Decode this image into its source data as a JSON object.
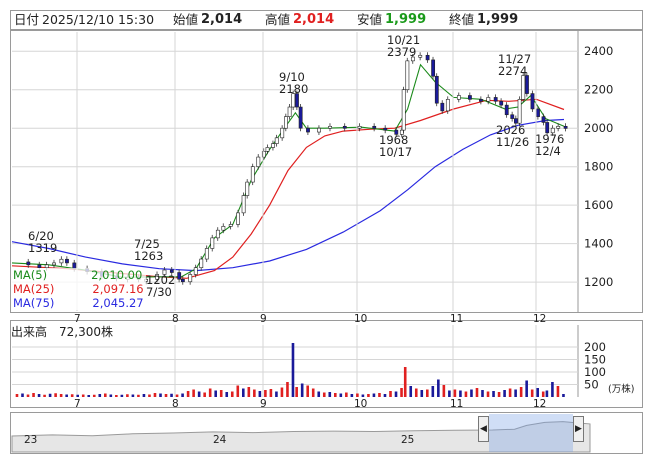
{
  "header": {
    "date_label": "日付",
    "date_value": "2025/12/10 15:30",
    "open_label": "始値",
    "open_value": "2,014",
    "high_label": "高値",
    "high_value": "2,014",
    "low_label": "安値",
    "low_value": "1,999",
    "close_label": "終値",
    "close_value": "1,999"
  },
  "legend": [
    {
      "label": "MA(5)",
      "value": "2,010.00",
      "color": "#1a8a1a"
    },
    {
      "label": "MA(25)",
      "value": "2,097.16",
      "color": "#e02020"
    },
    {
      "label": "MA(75)",
      "value": "2,045.27",
      "color": "#2a2ae0"
    }
  ],
  "volume_label": "出来高　72,300株",
  "colors": {
    "up": "#e02020",
    "down": "#1a1a9a",
    "ma5": "#1a8a1a",
    "ma25": "#e02020",
    "ma75": "#2a2ae0",
    "grid": "#d6d6d6"
  },
  "chart_data": {
    "type": "candlestick",
    "price_axis": {
      "ticks": [
        "1200",
        "1400",
        "1600",
        "1800",
        "2000",
        "2200",
        "2400"
      ],
      "range": [
        1050,
        2500
      ]
    },
    "month_ticks": [
      "7",
      "8",
      "9",
      "10",
      "11",
      "12"
    ],
    "volume_axis": {
      "ticks": [
        "200",
        "150",
        "100",
        "50"
      ],
      "unit": "(万株)",
      "range": [
        0,
        240
      ]
    },
    "annotations": [
      {
        "text": "6/20",
        "value": "1319"
      },
      {
        "text": "7/25",
        "value": "1263"
      },
      {
        "text": "1202",
        "value": "7/30"
      },
      {
        "text": "9/10",
        "value": "2180"
      },
      {
        "text": "10/21",
        "value": "2379"
      },
      {
        "text": "1968",
        "value": "10/17"
      },
      {
        "text": "11/27",
        "value": "2274"
      },
      {
        "text": "2026",
        "value": "11/26"
      },
      {
        "text": "1976",
        "value": "12/4"
      }
    ],
    "price_path": [
      [
        0,
        1305
      ],
      [
        8,
        1290
      ],
      [
        14,
        1275
      ],
      [
        18,
        1290
      ],
      [
        22,
        1300
      ],
      [
        26,
        1319
      ],
      [
        29,
        1300
      ],
      [
        33,
        1270
      ],
      [
        40,
        1255
      ],
      [
        48,
        1230
      ],
      [
        56,
        1220
      ],
      [
        62,
        1225
      ],
      [
        68,
        1215
      ],
      [
        72,
        1215
      ],
      [
        78,
        1240
      ],
      [
        82,
        1263
      ],
      [
        86,
        1250
      ],
      [
        90,
        1215
      ],
      [
        92,
        1202
      ],
      [
        96,
        1240
      ],
      [
        99,
        1275
      ],
      [
        102,
        1320
      ],
      [
        105,
        1375
      ],
      [
        108,
        1430
      ],
      [
        111,
        1470
      ],
      [
        114,
        1490
      ],
      [
        118,
        1500
      ],
      [
        122,
        1560
      ],
      [
        125,
        1650
      ],
      [
        127,
        1720
      ],
      [
        130,
        1800
      ],
      [
        133,
        1850
      ],
      [
        136,
        1880
      ],
      [
        138,
        1900
      ],
      [
        141,
        1920
      ],
      [
        143,
        1950
      ],
      [
        146,
        2000
      ],
      [
        148,
        2060
      ],
      [
        150,
        2110
      ],
      [
        152,
        2180
      ],
      [
        154,
        2110
      ],
      [
        156,
        2000
      ],
      [
        160,
        1980
      ],
      [
        166,
        2000
      ],
      [
        172,
        2010
      ],
      [
        180,
        2000
      ],
      [
        188,
        2010
      ],
      [
        196,
        2000
      ],
      [
        202,
        1990
      ],
      [
        208,
        1968
      ],
      [
        211,
        1990
      ],
      [
        212,
        2200
      ],
      [
        214,
        2350
      ],
      [
        217,
        2370
      ],
      [
        221,
        2379
      ],
      [
        225,
        2355
      ],
      [
        228,
        2270
      ],
      [
        230,
        2130
      ],
      [
        233,
        2090
      ],
      [
        236,
        2150
      ],
      [
        242,
        2170
      ],
      [
        248,
        2150
      ],
      [
        254,
        2140
      ],
      [
        258,
        2160
      ],
      [
        262,
        2140
      ],
      [
        265,
        2120
      ],
      [
        268,
        2070
      ],
      [
        271,
        2050
      ],
      [
        273,
        2026
      ],
      [
        275,
        2150
      ],
      [
        277,
        2274
      ],
      [
        279,
        2180
      ],
      [
        282,
        2100
      ],
      [
        285,
        2060
      ],
      [
        288,
        2030
      ],
      [
        290,
        1976
      ],
      [
        293,
        2000
      ],
      [
        296,
        2010
      ],
      [
        300,
        1999
      ]
    ],
    "ma5_path": [
      [
        0,
        1300
      ],
      [
        20,
        1290
      ],
      [
        40,
        1262
      ],
      [
        60,
        1225
      ],
      [
        80,
        1228
      ],
      [
        92,
        1228
      ],
      [
        100,
        1270
      ],
      [
        110,
        1430
      ],
      [
        120,
        1500
      ],
      [
        130,
        1730
      ],
      [
        140,
        1890
      ],
      [
        148,
        2000
      ],
      [
        154,
        2080
      ],
      [
        160,
        2000
      ],
      [
        170,
        2000
      ],
      [
        190,
        2005
      ],
      [
        208,
        1985
      ],
      [
        215,
        2100
      ],
      [
        222,
        2330
      ],
      [
        230,
        2240
      ],
      [
        240,
        2160
      ],
      [
        255,
        2150
      ],
      [
        268,
        2100
      ],
      [
        275,
        2110
      ],
      [
        282,
        2170
      ],
      [
        290,
        2050
      ],
      [
        300,
        2010
      ]
    ],
    "ma25_path": [
      [
        0,
        1285
      ],
      [
        30,
        1270
      ],
      [
        60,
        1245
      ],
      [
        80,
        1228
      ],
      [
        95,
        1220
      ],
      [
        110,
        1260
      ],
      [
        120,
        1330
      ],
      [
        130,
        1450
      ],
      [
        140,
        1600
      ],
      [
        150,
        1780
      ],
      [
        160,
        1900
      ],
      [
        170,
        1960
      ],
      [
        180,
        1985
      ],
      [
        195,
        1995
      ],
      [
        208,
        2000
      ],
      [
        222,
        2040
      ],
      [
        240,
        2100
      ],
      [
        258,
        2145
      ],
      [
        270,
        2140
      ],
      [
        285,
        2150
      ],
      [
        300,
        2097
      ]
    ],
    "ma75_path": [
      [
        0,
        1410
      ],
      [
        20,
        1375
      ],
      [
        40,
        1330
      ],
      [
        60,
        1295
      ],
      [
        80,
        1270
      ],
      [
        100,
        1260
      ],
      [
        120,
        1275
      ],
      [
        140,
        1310
      ],
      [
        160,
        1370
      ],
      [
        180,
        1460
      ],
      [
        200,
        1570
      ],
      [
        215,
        1680
      ],
      [
        230,
        1800
      ],
      [
        245,
        1890
      ],
      [
        260,
        1965
      ],
      [
        275,
        2015
      ],
      [
        290,
        2040
      ],
      [
        300,
        2045
      ]
    ],
    "volumes": [
      {
        "i": 2,
        "v": 12,
        "up": true
      },
      {
        "i": 5,
        "v": 14,
        "up": false
      },
      {
        "i": 8,
        "v": 10,
        "up": true
      },
      {
        "i": 11,
        "v": 16,
        "up": true
      },
      {
        "i": 14,
        "v": 12,
        "up": false
      },
      {
        "i": 17,
        "v": 9,
        "up": true
      },
      {
        "i": 20,
        "v": 13,
        "up": false
      },
      {
        "i": 23,
        "v": 15,
        "up": true
      },
      {
        "i": 26,
        "v": 12,
        "up": true
      },
      {
        "i": 29,
        "v": 10,
        "up": false
      },
      {
        "i": 32,
        "v": 11,
        "up": true
      },
      {
        "i": 35,
        "v": 9,
        "up": false
      },
      {
        "i": 38,
        "v": 10,
        "up": true
      },
      {
        "i": 41,
        "v": 8,
        "up": false
      },
      {
        "i": 44,
        "v": 9,
        "up": true
      },
      {
        "i": 47,
        "v": 12,
        "up": false
      },
      {
        "i": 50,
        "v": 14,
        "up": true
      },
      {
        "i": 53,
        "v": 10,
        "up": false
      },
      {
        "i": 56,
        "v": 8,
        "up": true
      },
      {
        "i": 59,
        "v": 9,
        "up": false
      },
      {
        "i": 62,
        "v": 11,
        "up": true
      },
      {
        "i": 65,
        "v": 10,
        "up": false
      },
      {
        "i": 68,
        "v": 9,
        "up": true
      },
      {
        "i": 71,
        "v": 12,
        "up": false
      },
      {
        "i": 74,
        "v": 10,
        "up": true
      },
      {
        "i": 77,
        "v": 16,
        "up": true
      },
      {
        "i": 80,
        "v": 14,
        "up": false
      },
      {
        "i": 83,
        "v": 12,
        "up": true
      },
      {
        "i": 86,
        "v": 13,
        "up": false
      },
      {
        "i": 89,
        "v": 10,
        "up": true
      },
      {
        "i": 92,
        "v": 14,
        "up": false
      },
      {
        "i": 95,
        "v": 24,
        "up": true
      },
      {
        "i": 98,
        "v": 30,
        "up": true
      },
      {
        "i": 101,
        "v": 22,
        "up": false
      },
      {
        "i": 104,
        "v": 18,
        "up": true
      },
      {
        "i": 107,
        "v": 34,
        "up": true
      },
      {
        "i": 110,
        "v": 26,
        "up": false
      },
      {
        "i": 113,
        "v": 28,
        "up": true
      },
      {
        "i": 116,
        "v": 20,
        "up": false
      },
      {
        "i": 119,
        "v": 22,
        "up": true
      },
      {
        "i": 122,
        "v": 46,
        "up": true
      },
      {
        "i": 125,
        "v": 34,
        "up": false
      },
      {
        "i": 128,
        "v": 40,
        "up": true
      },
      {
        "i": 131,
        "v": 30,
        "up": true
      },
      {
        "i": 134,
        "v": 24,
        "up": false
      },
      {
        "i": 137,
        "v": 28,
        "up": true
      },
      {
        "i": 140,
        "v": 32,
        "up": true
      },
      {
        "i": 143,
        "v": 22,
        "up": false
      },
      {
        "i": 146,
        "v": 38,
        "up": true
      },
      {
        "i": 149,
        "v": 60,
        "up": true
      },
      {
        "i": 152,
        "v": 216,
        "up": false
      },
      {
        "i": 154,
        "v": 40,
        "up": true
      },
      {
        "i": 157,
        "v": 54,
        "up": false
      },
      {
        "i": 160,
        "v": 46,
        "up": true
      },
      {
        "i": 163,
        "v": 34,
        "up": true
      },
      {
        "i": 166,
        "v": 22,
        "up": false
      },
      {
        "i": 169,
        "v": 18,
        "up": true
      },
      {
        "i": 172,
        "v": 20,
        "up": false
      },
      {
        "i": 175,
        "v": 16,
        "up": true
      },
      {
        "i": 178,
        "v": 14,
        "up": false
      },
      {
        "i": 181,
        "v": 18,
        "up": true
      },
      {
        "i": 184,
        "v": 12,
        "up": false
      },
      {
        "i": 187,
        "v": 14,
        "up": true
      },
      {
        "i": 190,
        "v": 10,
        "up": false
      },
      {
        "i": 193,
        "v": 12,
        "up": true
      },
      {
        "i": 196,
        "v": 14,
        "up": false
      },
      {
        "i": 199,
        "v": 16,
        "up": true
      },
      {
        "i": 202,
        "v": 12,
        "up": false
      },
      {
        "i": 205,
        "v": 24,
        "up": true
      },
      {
        "i": 208,
        "v": 22,
        "up": false
      },
      {
        "i": 211,
        "v": 36,
        "up": true
      },
      {
        "i": 213,
        "v": 120,
        "up": true
      },
      {
        "i": 216,
        "v": 44,
        "up": false
      },
      {
        "i": 219,
        "v": 34,
        "up": true
      },
      {
        "i": 222,
        "v": 28,
        "up": false
      },
      {
        "i": 225,
        "v": 30,
        "up": true
      },
      {
        "i": 228,
        "v": 44,
        "up": false
      },
      {
        "i": 231,
        "v": 70,
        "up": false
      },
      {
        "i": 234,
        "v": 48,
        "up": true
      },
      {
        "i": 237,
        "v": 26,
        "up": false
      },
      {
        "i": 240,
        "v": 30,
        "up": true
      },
      {
        "i": 243,
        "v": 26,
        "up": false
      },
      {
        "i": 246,
        "v": 22,
        "up": true
      },
      {
        "i": 249,
        "v": 30,
        "up": false
      },
      {
        "i": 252,
        "v": 36,
        "up": true
      },
      {
        "i": 255,
        "v": 28,
        "up": false
      },
      {
        "i": 258,
        "v": 22,
        "up": true
      },
      {
        "i": 261,
        "v": 24,
        "up": false
      },
      {
        "i": 264,
        "v": 20,
        "up": true
      },
      {
        "i": 267,
        "v": 28,
        "up": false
      },
      {
        "i": 270,
        "v": 34,
        "up": true
      },
      {
        "i": 273,
        "v": 30,
        "up": false
      },
      {
        "i": 276,
        "v": 40,
        "up": true
      },
      {
        "i": 279,
        "v": 66,
        "up": false
      },
      {
        "i": 282,
        "v": 30,
        "up": true
      },
      {
        "i": 285,
        "v": 36,
        "up": false
      },
      {
        "i": 288,
        "v": 22,
        "up": true
      },
      {
        "i": 290,
        "v": 26,
        "up": false
      },
      {
        "i": 293,
        "v": 60,
        "up": false
      },
      {
        "i": 296,
        "v": 44,
        "up": true
      },
      {
        "i": 299,
        "v": 12,
        "up": false
      }
    ],
    "navigator": {
      "labels": [
        "23",
        "24",
        "25"
      ],
      "path": [
        [
          0,
          0.58
        ],
        [
          40,
          0.55
        ],
        [
          80,
          0.57
        ],
        [
          120,
          0.52
        ],
        [
          160,
          0.5
        ],
        [
          200,
          0.47
        ],
        [
          240,
          0.49
        ],
        [
          280,
          0.46
        ],
        [
          320,
          0.45
        ],
        [
          360,
          0.46
        ],
        [
          400,
          0.44
        ],
        [
          440,
          0.43
        ],
        [
          478,
          0.42
        ],
        [
          500,
          0.4
        ],
        [
          512,
          0.3
        ],
        [
          530,
          0.22
        ],
        [
          548,
          0.2
        ],
        [
          565,
          0.24
        ],
        [
          575,
          0.26
        ]
      ]
    }
  }
}
